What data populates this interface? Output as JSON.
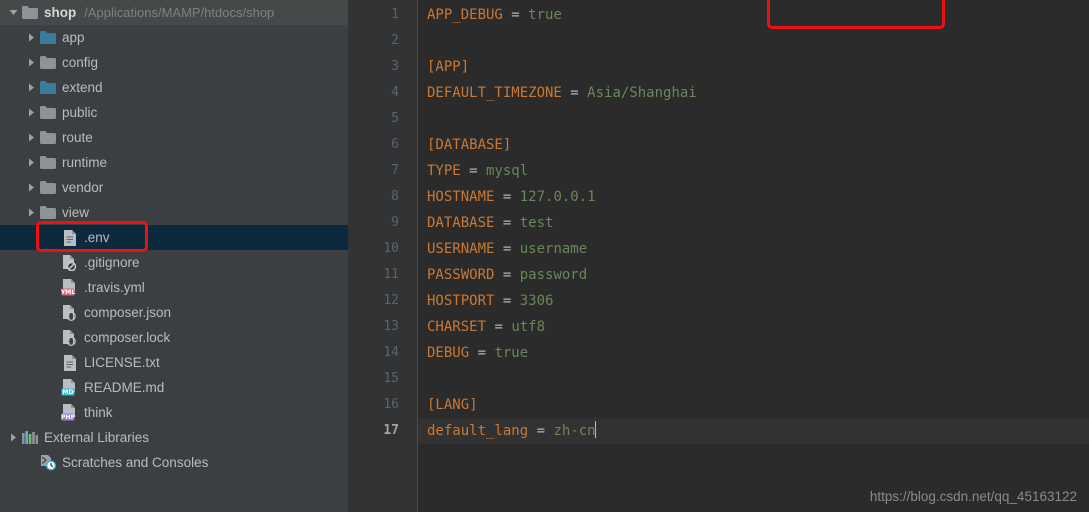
{
  "app": {
    "theme": "darcula",
    "colors": {
      "sidebar_bg": "#3c3f41",
      "editor_bg": "#2b2b2b",
      "gutter_bg": "#313335",
      "selection_bg": "#0d293e",
      "annotation": "#ee1111",
      "folder_blue": "#3b7b9b",
      "folder_gray": "#8d9499",
      "key_orange": "#cc7832",
      "value_green": "#6a8759",
      "operator_gray": "#a9b7c6"
    }
  },
  "sidebar": {
    "root": {
      "name": "shop",
      "path": "/Applications/MAMP/htdocs/shop",
      "expanded": true,
      "icon": "folder-icon",
      "arrow": "chevron-down-icon"
    },
    "items": [
      {
        "label": "app",
        "icon": "folder-icon",
        "badge": "",
        "arrow": "chevron-right-icon",
        "indent": 1,
        "folder_color": "blue",
        "selected": false
      },
      {
        "label": "config",
        "icon": "folder-icon",
        "badge": "",
        "arrow": "chevron-right-icon",
        "indent": 1,
        "folder_color": "gray",
        "selected": false
      },
      {
        "label": "extend",
        "icon": "folder-icon",
        "badge": "",
        "arrow": "chevron-right-icon",
        "indent": 1,
        "folder_color": "blue",
        "selected": false
      },
      {
        "label": "public",
        "icon": "folder-icon",
        "badge": "",
        "arrow": "chevron-right-icon",
        "indent": 1,
        "folder_color": "gray",
        "selected": false
      },
      {
        "label": "route",
        "icon": "folder-icon",
        "badge": "",
        "arrow": "chevron-right-icon",
        "indent": 1,
        "folder_color": "gray",
        "selected": false
      },
      {
        "label": "runtime",
        "icon": "folder-icon",
        "badge": "",
        "arrow": "chevron-right-icon",
        "indent": 1,
        "folder_color": "gray",
        "selected": false
      },
      {
        "label": "vendor",
        "icon": "folder-icon",
        "badge": "",
        "arrow": "chevron-right-icon",
        "indent": 1,
        "folder_color": "gray",
        "selected": false
      },
      {
        "label": "view",
        "icon": "folder-icon",
        "badge": "",
        "arrow": "chevron-right-icon",
        "indent": 1,
        "folder_color": "gray",
        "selected": false
      },
      {
        "label": ".env",
        "icon": "file-text-icon",
        "badge": "",
        "arrow": "",
        "indent": 2,
        "folder_color": "",
        "selected": true
      },
      {
        "label": ".gitignore",
        "icon": "file-ignore-icon",
        "badge": "",
        "arrow": "",
        "indent": 2,
        "folder_color": "",
        "selected": false
      },
      {
        "label": ".travis.yml",
        "icon": "file-yml-icon",
        "badge": "YML",
        "arrow": "",
        "indent": 2,
        "folder_color": "",
        "selected": false
      },
      {
        "label": "composer.json",
        "icon": "file-json-icon",
        "badge": "",
        "arrow": "",
        "indent": 2,
        "folder_color": "",
        "selected": false
      },
      {
        "label": "composer.lock",
        "icon": "file-json-icon",
        "badge": "",
        "arrow": "",
        "indent": 2,
        "folder_color": "",
        "selected": false
      },
      {
        "label": "LICENSE.txt",
        "icon": "file-text-icon",
        "badge": "",
        "arrow": "",
        "indent": 2,
        "folder_color": "",
        "selected": false
      },
      {
        "label": "README.md",
        "icon": "file-md-icon",
        "badge": "MD",
        "arrow": "",
        "indent": 2,
        "folder_color": "",
        "selected": false
      },
      {
        "label": "think",
        "icon": "file-php-icon",
        "badge": "PHP",
        "arrow": "",
        "indent": 2,
        "folder_color": "",
        "selected": false
      },
      {
        "label": "External Libraries",
        "icon": "libraries-icon",
        "badge": "",
        "arrow": "chevron-right-icon",
        "indent": 0,
        "folder_color": "",
        "selected": false
      },
      {
        "label": "Scratches and Consoles",
        "icon": "scratches-icon",
        "badge": "",
        "arrow": "",
        "indent": 1,
        "folder_color": "",
        "selected": false
      }
    ]
  },
  "editor": {
    "current_line": 17,
    "caret_line": 17,
    "line_numbers": [
      1,
      2,
      3,
      4,
      5,
      6,
      7,
      8,
      9,
      10,
      11,
      12,
      13,
      14,
      15,
      16,
      17
    ],
    "lines": [
      {
        "n": 1,
        "type": "pair",
        "key": "APP_DEBUG",
        "eq": " = ",
        "value": "true"
      },
      {
        "n": 2,
        "type": "blank",
        "key": "",
        "eq": "",
        "value": ""
      },
      {
        "n": 3,
        "type": "section",
        "key": "[APP]",
        "eq": "",
        "value": ""
      },
      {
        "n": 4,
        "type": "pair",
        "key": "DEFAULT_TIMEZONE",
        "eq": " = ",
        "value": "Asia/Shanghai"
      },
      {
        "n": 5,
        "type": "blank",
        "key": "",
        "eq": "",
        "value": ""
      },
      {
        "n": 6,
        "type": "section",
        "key": "[DATABASE]",
        "eq": "",
        "value": ""
      },
      {
        "n": 7,
        "type": "pair",
        "key": "TYPE",
        "eq": " = ",
        "value": "mysql"
      },
      {
        "n": 8,
        "type": "pair",
        "key": "HOSTNAME",
        "eq": " = ",
        "value": "127.0.0.1"
      },
      {
        "n": 9,
        "type": "pair",
        "key": "DATABASE",
        "eq": " = ",
        "value": "test"
      },
      {
        "n": 10,
        "type": "pair",
        "key": "USERNAME",
        "eq": " = ",
        "value": "username"
      },
      {
        "n": 11,
        "type": "pair",
        "key": "PASSWORD",
        "eq": " = ",
        "value": "password"
      },
      {
        "n": 12,
        "type": "pair",
        "key": "HOSTPORT",
        "eq": " = ",
        "value": "3306"
      },
      {
        "n": 13,
        "type": "pair",
        "key": "CHARSET",
        "eq": " = ",
        "value": "utf8"
      },
      {
        "n": 14,
        "type": "pair",
        "key": "DEBUG",
        "eq": " = ",
        "value": "true"
      },
      {
        "n": 15,
        "type": "blank",
        "key": "",
        "eq": "",
        "value": ""
      },
      {
        "n": 16,
        "type": "section",
        "key": "[LANG]",
        "eq": "",
        "value": ""
      },
      {
        "n": 17,
        "type": "pair",
        "key": "default_lang",
        "eq": " = ",
        "value": "zh-cn"
      }
    ]
  },
  "annotations": {
    "env_box_label": "highlight-env-file",
    "code_box_label": "highlight-app-debug-line"
  },
  "watermark": {
    "text": "https://blog.csdn.net/qq_45163122"
  }
}
